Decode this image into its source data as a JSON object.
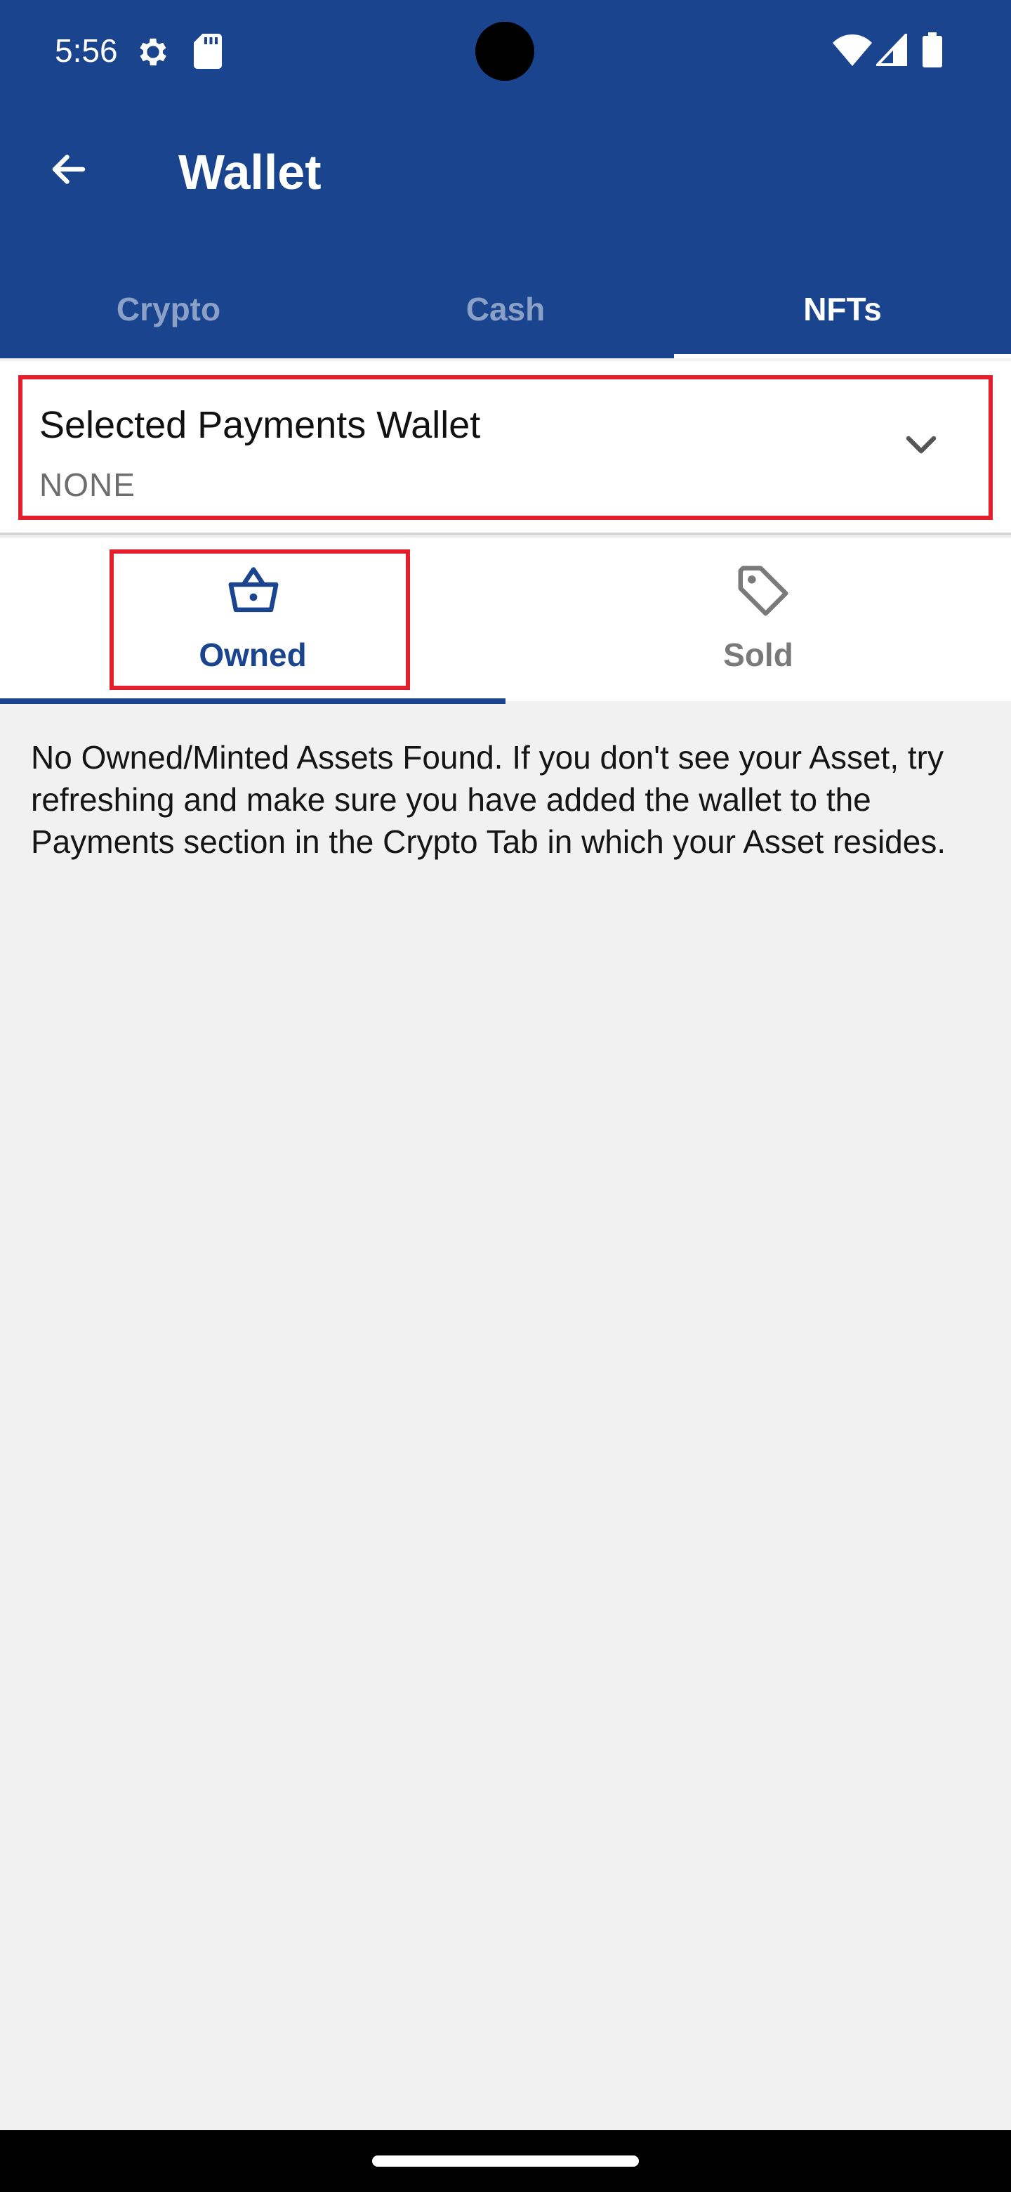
{
  "status_bar": {
    "time": "5:56",
    "icons": [
      "settings-gear-icon",
      "sd-card-icon",
      "wifi-icon",
      "cellular-signal-icon",
      "battery-icon"
    ]
  },
  "app_bar": {
    "title": "Wallet",
    "back_icon": "arrow-left-icon",
    "color": "#1a458e"
  },
  "top_tabs": [
    {
      "label": "Crypto",
      "active": false
    },
    {
      "label": "Cash",
      "active": false
    },
    {
      "label": "NFTs",
      "active": true
    }
  ],
  "wallet_selector": {
    "label": "Selected Payments Wallet",
    "value": "NONE",
    "icon": "chevron-down-icon"
  },
  "sub_tabs": [
    {
      "label": "Owned",
      "icon": "basket-icon",
      "active": true
    },
    {
      "label": "Sold",
      "icon": "tag-icon",
      "active": false
    }
  ],
  "empty_message": "No Owned/Minted Assets Found. If you don't see your Asset, try refreshing and make sure you have added the wallet to the Payments section in the Crypto Tab in which your Asset resides.",
  "colors": {
    "accent": "#1a458e",
    "highlight": "#e31e2d",
    "background": "#f1f1f1"
  }
}
